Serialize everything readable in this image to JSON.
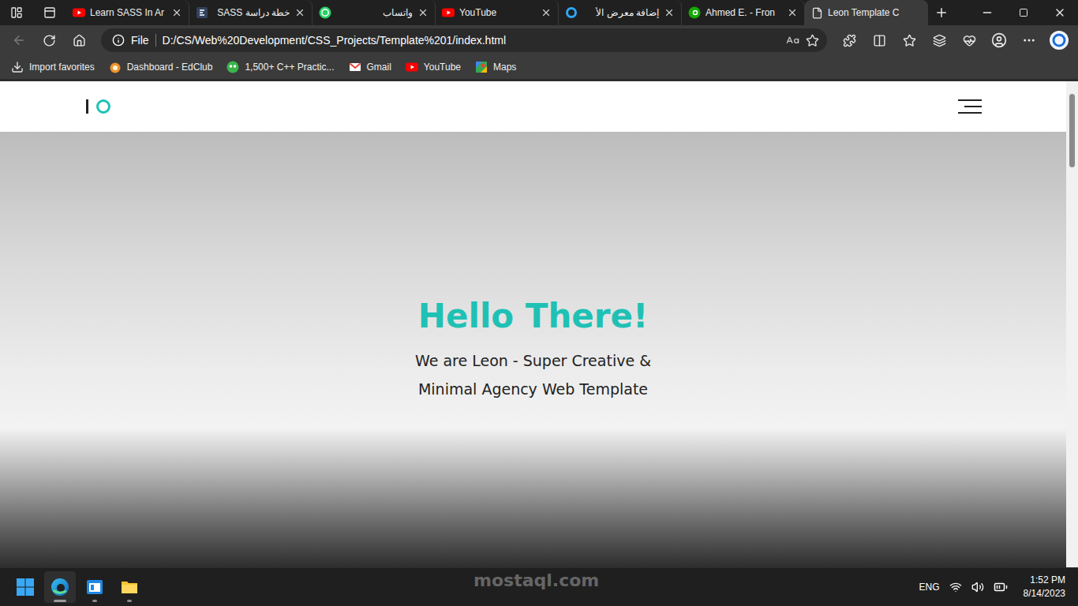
{
  "browser": {
    "tabs": [
      {
        "label": "Learn SASS In Ar",
        "kind": "youtube",
        "selected": false
      },
      {
        "label": "خطة دراسة SASS",
        "kind": "edraak",
        "selected": false
      },
      {
        "label": "واتساب",
        "kind": "whatsapp",
        "selected": false
      },
      {
        "label": "YouTube",
        "kind": "youtube",
        "selected": false
      },
      {
        "label": "إضافة معرض الأ",
        "kind": "ring",
        "selected": false
      },
      {
        "label": "Ahmed E. - Fron",
        "kind": "upwork",
        "selected": false
      },
      {
        "label": "Leon Template C",
        "kind": "page",
        "selected": true
      }
    ],
    "back_enabled": false,
    "address": {
      "scheme": "File",
      "url": "D:/CS/Web%20Development/CSS_Projects/Template%201/index.html"
    },
    "favorites": [
      {
        "label": "Import favorites",
        "kind": "import"
      },
      {
        "label": "Dashboard - EdClub",
        "kind": "edclub"
      },
      {
        "label": "1,500+ C++ Practic...",
        "kind": "cpp"
      },
      {
        "label": "Gmail",
        "kind": "gmail"
      },
      {
        "label": "YouTube",
        "kind": "youtube"
      },
      {
        "label": "Maps",
        "kind": "maps"
      }
    ]
  },
  "page": {
    "hero": {
      "title": "Hello There!",
      "subtitle_lines": [
        "We are Leon - Super Creative &",
        "Minimal Agency Web Template"
      ]
    },
    "scrollbar": {
      "level": 0.16
    }
  },
  "taskbar": {
    "apps": [
      {
        "kind": "start",
        "running": false,
        "selected": false
      },
      {
        "kind": "edge",
        "running": true,
        "selected": true
      },
      {
        "kind": "notes",
        "running": true,
        "selected": false
      },
      {
        "kind": "explorer",
        "running": true,
        "selected": false
      }
    ],
    "language": "ENG",
    "time": "1:52 PM",
    "date": "8/14/2023"
  },
  "watermark": "mostaql.com"
}
